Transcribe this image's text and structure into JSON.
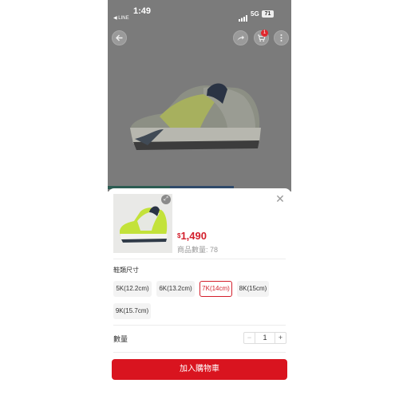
{
  "statusbar": {
    "time": "1:49",
    "back_app": "◀ LINE",
    "network": "5G",
    "battery": "71"
  },
  "nav": {
    "cart_count": "1"
  },
  "product": {
    "price_currency": "$",
    "price": "1,490",
    "stock_label": "商品數量: 78"
  },
  "size_section": {
    "title": "鞋類尺寸",
    "options": [
      "5K(12.2cm)",
      "6K(13.2cm)",
      "7K(14cm)",
      "8K(15cm)",
      "9K(15.7cm)"
    ],
    "selected": "7K(14cm)"
  },
  "quantity": {
    "label": "數量",
    "value": "1",
    "minus": "−",
    "plus": "+"
  },
  "actions": {
    "add_to_cart": "加入購物車"
  },
  "colors": {
    "accent": "#d9141f",
    "price": "#d31f2c",
    "shoe_lime": "#c3e23a",
    "backdrop": "#7b7b7b"
  },
  "icons": [
    "back-arrow-icon",
    "share-icon",
    "cart-icon",
    "more-icon",
    "close-icon",
    "zoom-icon"
  ]
}
